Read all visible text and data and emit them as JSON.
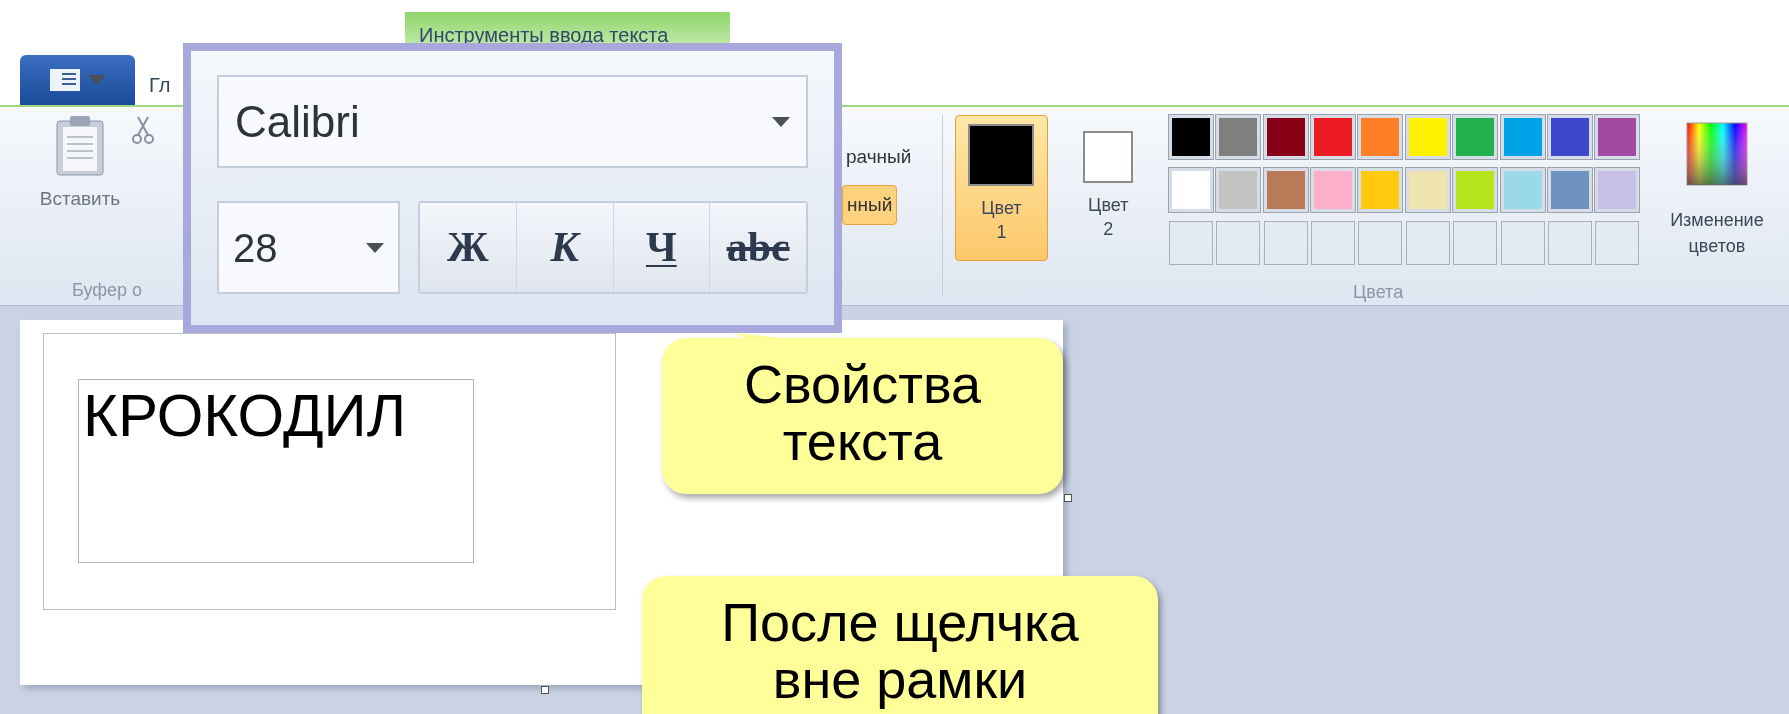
{
  "contextual_tab": "Инструменты ввода текста",
  "ribbon_tab": {
    "label": "Гл",
    "selected": false
  },
  "clipboard": {
    "paste": "Вставить",
    "group_label": "Буфер о"
  },
  "background_options": [
    {
      "label": "рачный",
      "selected": false
    },
    {
      "label": "нный",
      "selected": true
    }
  ],
  "colors": {
    "color_1": {
      "label": "Цвет",
      "index": "1",
      "selected": true,
      "color": "#000000"
    },
    "color_2": {
      "label": "Цвет",
      "index": "2",
      "selected": false,
      "color": "#ffffff"
    },
    "palette": [
      {
        "color": "#000000"
      },
      {
        "color": "#7f7f7f"
      },
      {
        "color": "#880015"
      },
      {
        "color": "#ed1c24"
      },
      {
        "color": "#ff7f27"
      },
      {
        "color": "#fff200"
      },
      {
        "color": "#22b14c"
      },
      {
        "color": "#00a2e8"
      },
      {
        "color": "#3f48cc"
      },
      {
        "color": "#a349a4"
      },
      {
        "color": "#ffffff"
      },
      {
        "color": "#c3c3c3"
      },
      {
        "color": "#b97a57"
      },
      {
        "color": "#ffaec9"
      },
      {
        "color": "#ffc90e"
      },
      {
        "color": "#efe4b0"
      },
      {
        "color": "#b5e61d"
      },
      {
        "color": "#99d9ea"
      },
      {
        "color": "#7092be"
      },
      {
        "color": "#c8bfe7"
      }
    ],
    "edit_colors": "Изменение цветов",
    "group_label": "Цвета"
  },
  "text_popup": {
    "font": "Calibri",
    "size": "28",
    "styles": [
      {
        "label": "Ж",
        "kind": "bold"
      },
      {
        "label": "К",
        "kind": "italic"
      },
      {
        "label": "Ч",
        "kind": "underline"
      },
      {
        "label": "abc",
        "kind": "strikethrough"
      }
    ]
  },
  "canvas": {
    "text": "КРОКОДИЛ"
  },
  "callouts": [
    {
      "lines": [
        "Свойства",
        "текста"
      ]
    },
    {
      "lines": [
        "После щелчка",
        "вне рамки"
      ]
    }
  ]
}
